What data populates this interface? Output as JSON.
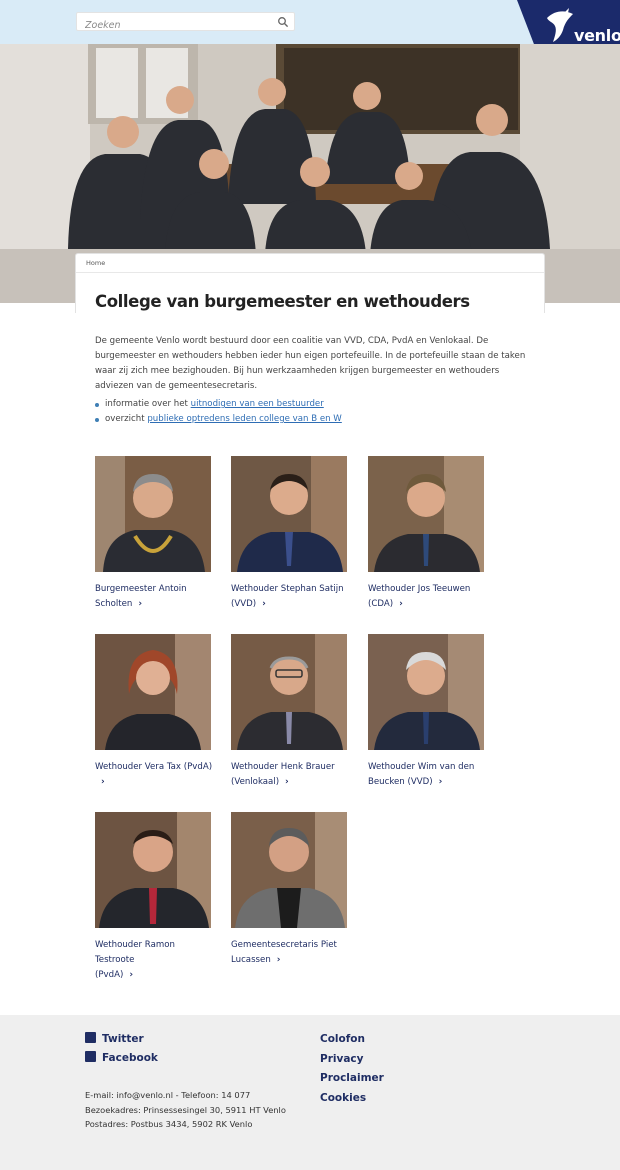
{
  "header": {
    "search_placeholder": "Zoeken",
    "logo_text": "venlo"
  },
  "breadcrumb": {
    "home": "Home"
  },
  "page": {
    "title": "College van burgemeester en wethouders",
    "intro": "De gemeente Venlo wordt bestuurd door een coalitie van VVD, CDA, PvdA en Venlokaal. De burgemeester en wethouders hebben ieder hun eigen portefeuille. In de portefeuille staan de taken waar zij zich mee bezighouden. Bij hun werkzaamheden krijgen burgemeester en wethouders adviezen van de gemeentesecretaris.",
    "bullets": [
      {
        "prefix": "informatie over het ",
        "link": "uitnodigen van een bestuurder"
      },
      {
        "prefix": "overzicht ",
        "link": "publieke optredens leden college van B en W"
      }
    ]
  },
  "people": [
    {
      "line1": "Burgemeester Antoin",
      "line2": "Scholten"
    },
    {
      "line1": "Wethouder Stephan Satijn",
      "line2": "(VVD)"
    },
    {
      "line1": "Wethouder Jos Teeuwen",
      "line2": "(CDA)"
    },
    {
      "line1": "Wethouder Vera Tax (PvdA)",
      "line2": ""
    },
    {
      "line1": "Wethouder Henk Brauer",
      "line2": "(Venlokaal)"
    },
    {
      "line1": "Wethouder Wim van den",
      "line2": "Beucken (VVD)"
    },
    {
      "line1": "Wethouder Ramon Testroote",
      "line2": "(PvdA)"
    },
    {
      "line1": "Gemeentesecretaris Piet",
      "line2": "Lucassen"
    }
  ],
  "footer": {
    "twitter": "Twitter",
    "facebook": "Facebook",
    "links": [
      "Colofon",
      "Privacy",
      "Proclaimer",
      "Cookies"
    ],
    "contact_line1": "E-mail: info@venlo.nl - Telefoon: 14 077",
    "contact_line2": "Bezoekadres: Prinsessesingel 30, 5911 HT Venlo",
    "contact_line3": "Postadres: Postbus 3434, 5902 RK Venlo"
  },
  "colors": {
    "topbar": "#d9ebf7",
    "brand_navy": "#1b2a6b",
    "link": "#2e6db4",
    "footer_bg": "#efefef"
  }
}
